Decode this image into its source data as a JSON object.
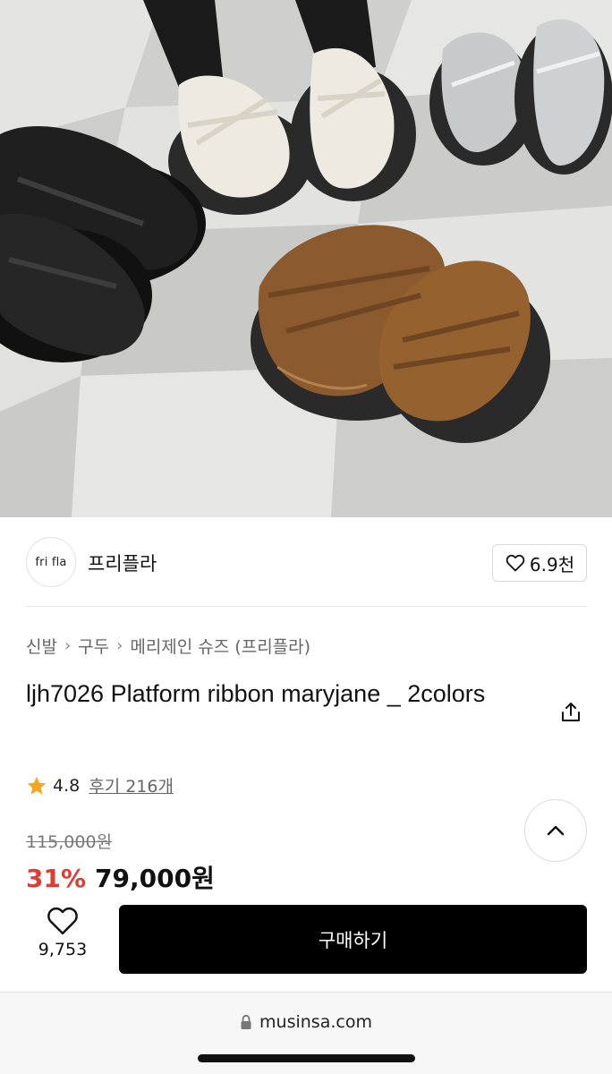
{
  "shop": {
    "logo_text": "fri fla",
    "name": "프리플라",
    "likes": "6.9천"
  },
  "breadcrumb": {
    "items": [
      "신발",
      "구두",
      "메리제인 슈즈 (프리플라)"
    ]
  },
  "product": {
    "title": "ljh7026 Platform ribbon maryjane _ 2colors",
    "rating": "4.8",
    "reviews": "후기 216개",
    "original_price": "115,000원",
    "discount": "31%",
    "sale_price": "79,000원"
  },
  "actions": {
    "wish_count": "9,753",
    "buy_label": "구매하기"
  },
  "browser": {
    "url": "musinsa.com"
  },
  "icons": {
    "heart": "heart-icon",
    "share": "share-icon",
    "star": "star-icon",
    "chevron_up": "chevron-up-icon",
    "lock": "lock-icon"
  },
  "colors": {
    "discount": "#e03c31",
    "star": "#f5a623",
    "buy_button": "#000000"
  }
}
